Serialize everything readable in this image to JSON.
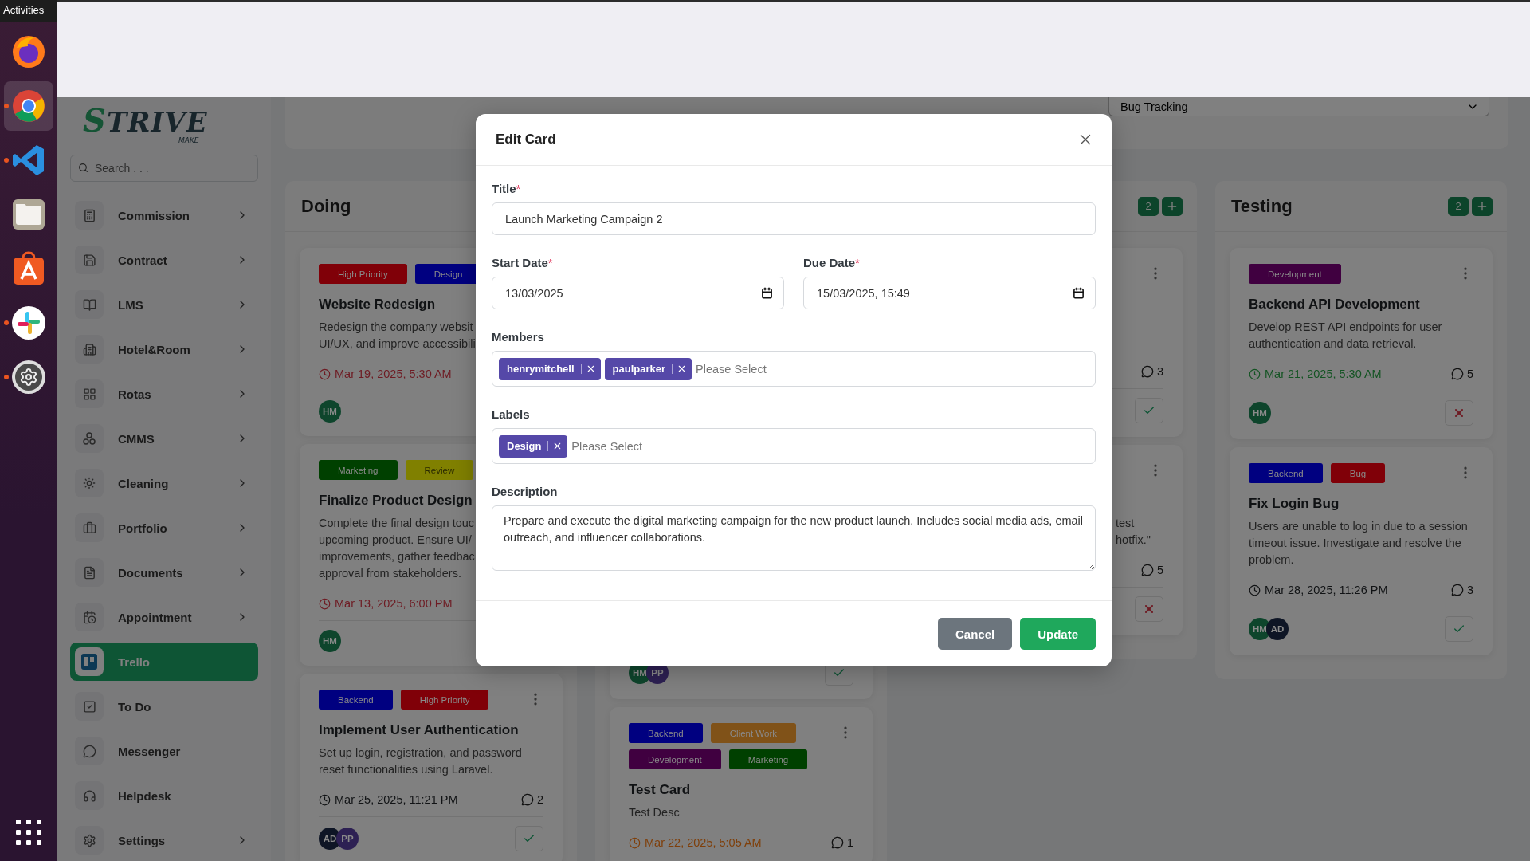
{
  "top_bar": {
    "activities": "Activities"
  },
  "dock": [
    {
      "running": false,
      "selected": false
    },
    {
      "running": true,
      "selected": true
    },
    {
      "running": true,
      "selected": false
    },
    {
      "running": false,
      "selected": false
    },
    {
      "running": false,
      "selected": false
    },
    {
      "running": true,
      "selected": false
    },
    {
      "running": true,
      "selected": false
    }
  ],
  "sidebar": {
    "logo": "STRIVE",
    "logo_tagline": "MAKE",
    "search_placeholder": "Search . . .",
    "items": [
      {
        "label": "Commission",
        "expandable": true,
        "selected": false
      },
      {
        "label": "Contract",
        "expandable": true,
        "selected": false
      },
      {
        "label": "LMS",
        "expandable": true,
        "selected": false
      },
      {
        "label": "Hotel&Room",
        "expandable": true,
        "selected": false
      },
      {
        "label": "Rotas",
        "expandable": true,
        "selected": false
      },
      {
        "label": "CMMS",
        "expandable": true,
        "selected": false
      },
      {
        "label": "Cleaning",
        "expandable": true,
        "selected": false
      },
      {
        "label": "Portfolio",
        "expandable": true,
        "selected": false
      },
      {
        "label": "Documents",
        "expandable": true,
        "selected": false
      },
      {
        "label": "Appointment",
        "expandable": true,
        "selected": false
      },
      {
        "label": "Trello",
        "expandable": false,
        "selected": true
      },
      {
        "label": "To Do",
        "expandable": false,
        "selected": false
      },
      {
        "label": "Messenger",
        "expandable": false,
        "selected": false
      },
      {
        "label": "Helpdesk",
        "expandable": false,
        "selected": false
      },
      {
        "label": "Settings",
        "expandable": true,
        "selected": false
      }
    ]
  },
  "board_filter": {
    "value": "Bug Tracking"
  },
  "columns": [
    {
      "title": "Doing",
      "cards": [
        {
          "labels": [
            {
              "text": "High Priority",
              "color": "#800008"
            },
            {
              "text": "Design",
              "color": "#000080"
            }
          ],
          "title": "Website Redesign",
          "description": [
            "Redesign the company websit",
            "UI/UX, and improve accessibili"
          ],
          "due": {
            "text": "Mar 19, 2025, 5:30 AM",
            "color": "#6e1b23"
          },
          "members": [
            {
              "initials": "HM",
              "color": "#0e452c"
            }
          ]
        },
        {
          "labels": [
            {
              "text": "Marketing",
              "color": "#004000"
            },
            {
              "text": "Review",
              "color": "#808000"
            }
          ],
          "title": "Finalize Product Design",
          "description": [
            "Complete the final design touc",
            "upcoming product. Ensure UI/",
            "improvements, gather feedbac",
            "approval from stakeholders."
          ],
          "due": {
            "text": "Mar 13, 2025, 6:00 PM",
            "color": "#6e1b23"
          },
          "members": [
            {
              "initials": "HM",
              "color": "#0e452c"
            }
          ]
        },
        {
          "labels": [
            {
              "text": "Backend",
              "color": "#000080"
            },
            {
              "text": "High Priority",
              "color": "#800008"
            }
          ],
          "menu": true,
          "title": "Implement User Authentication",
          "description": [
            "Set up login, registration, and password",
            "reset functionalities using Laravel."
          ],
          "due": {
            "text": "Mar 25, 2025, 11:21 PM",
            "color": "#111315"
          },
          "comments": "2",
          "members": [
            {
              "initials": "AD",
              "color": "#0e1525"
            },
            {
              "initials": "PP",
              "color": "#2d2053"
            }
          ],
          "action": {
            "kind": "check"
          }
        }
      ]
    },
    {
      "cards": [
        {
          "members": [
            {
              "initials": "HM",
              "color": "#0e452c"
            },
            {
              "initials": "PP",
              "color": "#2d2053"
            }
          ],
          "action": {
            "kind": "check"
          }
        },
        {
          "labels": [
            {
              "text": "Backend",
              "color": "#000080"
            },
            {
              "text": "Client Work",
              "color": "#805218"
            },
            {
              "text": "Development",
              "color": "#400040"
            },
            {
              "text": "Marketing",
              "color": "#004000"
            }
          ],
          "menu": true,
          "title": "Test Card",
          "description": [
            "Test Desc"
          ],
          "due": {
            "text": "Mar 22, 2025, 5:05 AM",
            "color": "#7f3f0a"
          },
          "comments": "1"
        }
      ]
    },
    {
      "count": "2",
      "cards": [
        {
          "menu": true,
          "comments": "3",
          "action": {
            "kind": "check"
          }
        },
        {
          "menu": true,
          "description": [
            "test",
            "hotfix.\""
          ],
          "comments": "5",
          "action": {
            "kind": "cross"
          }
        }
      ]
    },
    {
      "title": "Testing",
      "count": "2",
      "cards": [
        {
          "labels": [
            {
              "text": "Development",
              "color": "#400040"
            }
          ],
          "menu": true,
          "title": "Backend API Development",
          "description": [
            "Develop REST API endpoints for user",
            "authentication and data retrieval."
          ],
          "due": {
            "text": "Mar 21, 2025, 5:30 AM",
            "color": "#145423"
          },
          "comments": "5",
          "members": [
            {
              "initials": "HM",
              "color": "#0e452c"
            }
          ],
          "action": {
            "kind": "cross"
          }
        },
        {
          "labels": [
            {
              "text": "Backend",
              "color": "#000080"
            },
            {
              "text": "Bug",
              "color": "#800008"
            }
          ],
          "menu": true,
          "title": "Fix Login Bug",
          "description": [
            "Users are unable to log in due to a session",
            "timeout issue. Investigate and resolve the",
            "problem."
          ],
          "due": {
            "text": "Mar 28, 2025, 11:26 PM",
            "color": "#111315"
          },
          "comments": "3",
          "members": [
            {
              "initials": "HM",
              "color": "#0e452c"
            },
            {
              "initials": "AD",
              "color": "#0e1525"
            }
          ],
          "action": {
            "kind": "check"
          }
        }
      ]
    }
  ],
  "modal": {
    "title": "Edit Card",
    "title_field": {
      "label": "Title",
      "marker": "*",
      "value": "Launch Marketing Campaign 2"
    },
    "start_date": {
      "label": "Start Date",
      "marker": "*",
      "value": "13/03/2025"
    },
    "due_date": {
      "label": "Due Date",
      "marker": "*",
      "value": "15/03/2025, 15:49"
    },
    "members": {
      "label": "Members",
      "chips": [
        "henrymitchell",
        "paulparker"
      ],
      "placeholder": "Please Select"
    },
    "labels": {
      "label": "Labels",
      "chips": [
        "Design"
      ],
      "placeholder": "Please Select"
    },
    "description": {
      "label": "Description",
      "value": "Prepare and execute the digital marketing campaign for the new product launch. Includes social media ads, email outreach, and influencer collaborations."
    },
    "buttons": [
      {
        "label": "Cancel",
        "kind": "secondary"
      },
      {
        "label": "Update",
        "kind": "primary"
      }
    ]
  }
}
